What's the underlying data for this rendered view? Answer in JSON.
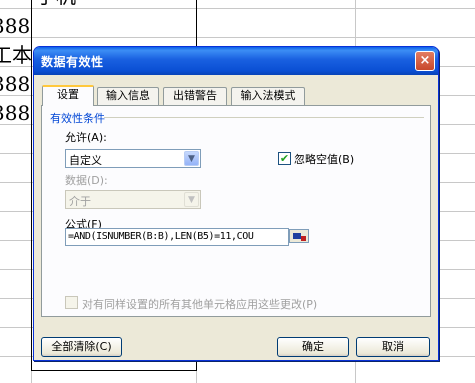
{
  "sheet": {
    "cells": [
      "手机",
      "388",
      "工本",
      "388",
      "388"
    ]
  },
  "dialog": {
    "title": "数据有效性",
    "close_label": "×",
    "tabs": [
      {
        "label": "设置",
        "active": true
      },
      {
        "label": "输入信息",
        "active": false
      },
      {
        "label": "出错警告",
        "active": false
      },
      {
        "label": "输入法模式",
        "active": false
      }
    ],
    "group_title": "有效性条件",
    "allow": {
      "label": "允许(A):",
      "value": "自定义"
    },
    "ignore_blank": {
      "label": "忽略空值(B)",
      "checked": true
    },
    "data_field": {
      "label": "数据(D):",
      "value": "介于"
    },
    "formula": {
      "label": "公式(F)",
      "value": "=AND(ISNUMBER(B:B),LEN(B5)=11,COU"
    },
    "apply_all": {
      "label": "对有同样设置的所有其他单元格应用这些更改(P)",
      "checked": false
    },
    "buttons": {
      "clear_all": "全部清除(C)",
      "ok": "确定",
      "cancel": "取消"
    }
  },
  "colors": {
    "titlebar": "#0a4fd4",
    "dialog_bg": "#ece9d8",
    "group_label": "#0046d5"
  }
}
